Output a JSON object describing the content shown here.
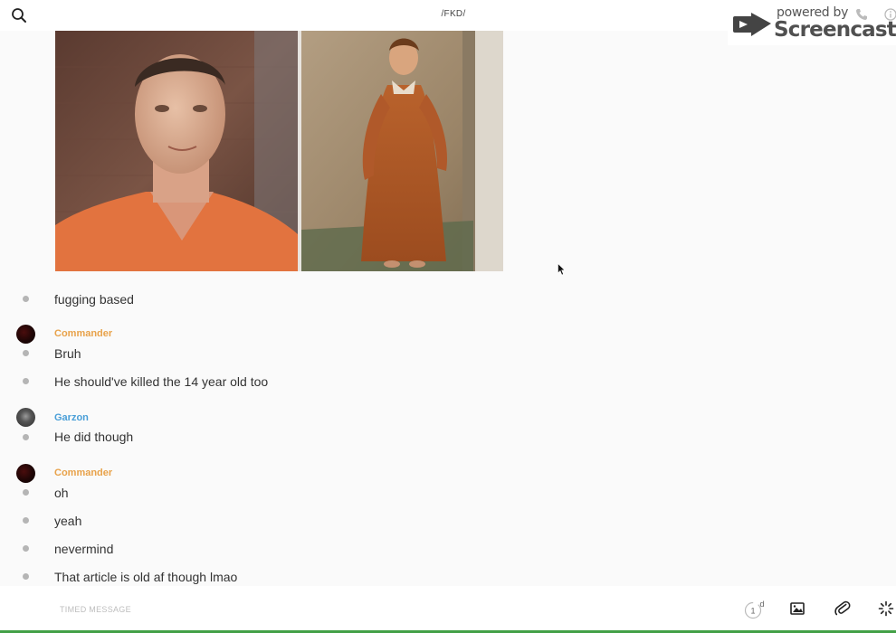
{
  "header": {
    "title": "/FKD/"
  },
  "watermark": {
    "powered_by": "powered by",
    "brand": "Screencastify"
  },
  "messages": [
    {
      "text": "fugging based"
    },
    {
      "sender": "Commander",
      "sender_color": "#e8a24a",
      "text": "Bruh"
    },
    {
      "text": "He should've killed the 14 year old too"
    },
    {
      "sender": "Garzon",
      "sender_color": "#4a9fd8",
      "text": "He did though"
    },
    {
      "sender": "Commander",
      "sender_color": "#e8a24a",
      "text": "oh"
    },
    {
      "text": "yeah"
    },
    {
      "text": "nevermind"
    },
    {
      "text": "That article is old af though lmao"
    }
  ],
  "composer": {
    "placeholder": "TIMED MESSAGE",
    "timer_value": "1",
    "timer_unit": "d"
  },
  "icons": {
    "search": "search-icon",
    "image": "image-icon",
    "attach": "paperclip-icon",
    "more": "sparkle-icon"
  }
}
